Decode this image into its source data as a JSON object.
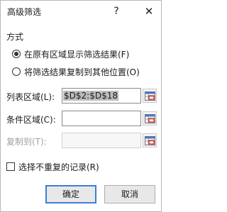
{
  "dialog": {
    "title": "高级筛选",
    "help_glyph": "?",
    "close_glyph": "✕"
  },
  "mode": {
    "label": "方式",
    "options": [
      {
        "label": "在原有区域显示筛选结果(F)",
        "checked": true
      },
      {
        "label": "将筛选结果复制到其他位置(O)",
        "checked": false
      }
    ]
  },
  "fields": {
    "list_range": {
      "label": "列表区域(L):",
      "value": "$D$2:$D$18"
    },
    "criteria_range": {
      "label": "条件区域(C):",
      "value": ""
    },
    "copy_to": {
      "label": "复制到(T):",
      "value": ""
    }
  },
  "unique": {
    "label": "选择不重复的记录(R)",
    "checked": false
  },
  "buttons": {
    "ok": "确定",
    "cancel": "取消"
  }
}
